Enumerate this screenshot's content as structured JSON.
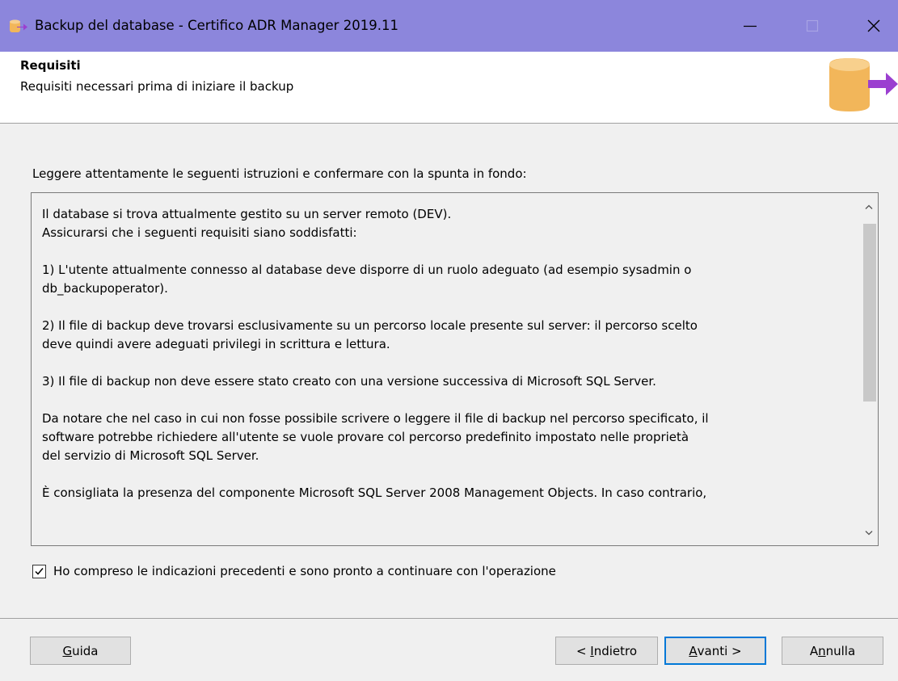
{
  "window": {
    "title": "Backup del database - Certifico ADR Manager 2019.11"
  },
  "header": {
    "title": "Requisiti",
    "subtitle": "Requisiti necessari prima di iniziare il backup"
  },
  "instruction": "Leggere attentamente le seguenti istruzioni e confermare con la spunta in fondo:",
  "textbox": {
    "p1": [
      "Il database si trova attualmente gestito su un server remoto (DEV).",
      "Assicurarsi che i seguenti requisiti siano soddisfatti:"
    ],
    "p2": [
      "1) L'utente attualmente connesso al database deve disporre di un ruolo adeguato (ad esempio sysadmin o",
      "db_backupoperator)."
    ],
    "p3": [
      "2) Il file di backup deve trovarsi esclusivamente su un percorso locale presente sul server: il percorso scelto",
      "deve quindi avere adeguati privilegi in scrittura e lettura."
    ],
    "p4": [
      "3) Il file di backup non deve essere stato creato con una versione successiva di Microsoft SQL Server."
    ],
    "p5": [
      "Da notare che nel caso in cui non fosse possibile scrivere o leggere il file di backup nel percorso specificato, il",
      "software potrebbe richiedere all'utente se vuole provare col percorso predefinito impostato nelle proprietà",
      "del servizio di Microsoft SQL Server."
    ],
    "p6": [
      "È consigliata la presenza del componente Microsoft SQL Server 2008 Management Objects. In caso contrario,"
    ]
  },
  "confirm": {
    "label": "Ho compreso le indicazioni precedenti e sono pronto a continuare con l'operazione",
    "checked": true
  },
  "buttons": {
    "help": {
      "pre": "",
      "key": "G",
      "post": "uida"
    },
    "back": {
      "pre": "< ",
      "key": "I",
      "post": "ndietro"
    },
    "next": {
      "pre": "",
      "key": "A",
      "post": "vanti >"
    },
    "cancel": {
      "pre": "A",
      "key": "n",
      "post": "nulla"
    }
  },
  "colors": {
    "titlebar": "#8c86dc",
    "db_icon": "#f2b65a",
    "arrow": "#9b3fd0",
    "default_button_border": "#0078d7"
  },
  "icons": {
    "app": "database-export-icon",
    "header": "database-export-icon",
    "minimize": "minimize-icon",
    "maximize": "maximize-icon",
    "close": "close-icon"
  }
}
